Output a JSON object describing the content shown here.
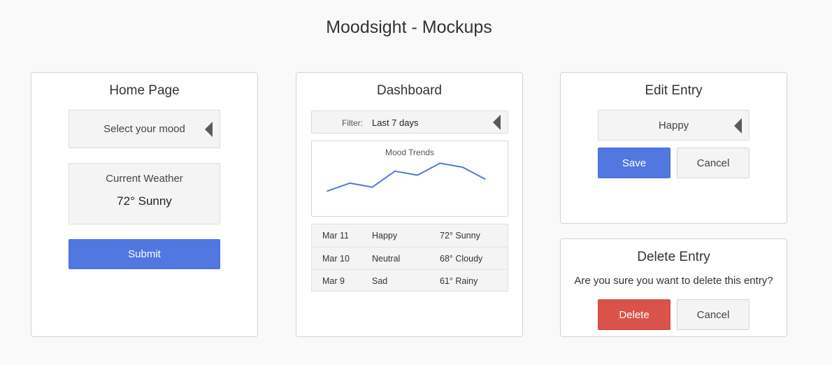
{
  "page": {
    "title": "Moodsight - Mockups"
  },
  "home": {
    "title": "Home Page",
    "mood_select": "Select your mood",
    "weather_label": "Current Weather",
    "weather_value": "72° Sunny",
    "submit_label": "Submit"
  },
  "dashboard": {
    "title": "Dashboard",
    "filter_label": "Filter:",
    "filter_value": "Last 7 days",
    "entries": [
      {
        "date": "Mar 11",
        "mood": "Happy",
        "weather": "72° Sunny"
      },
      {
        "date": "Mar 10",
        "mood": "Neutral",
        "weather": "68° Cloudy"
      },
      {
        "date": "Mar 9",
        "mood": "Sad",
        "weather": "61° Rainy"
      }
    ]
  },
  "chart_data": {
    "type": "line",
    "title": "Mood Trends",
    "xlabel": "",
    "ylabel": "",
    "grid": false,
    "series": [
      {
        "values": [
          1,
          3,
          2,
          6,
          5,
          8,
          7,
          4
        ]
      }
    ],
    "ylim": [
      0,
      10
    ],
    "color": "#5277e0"
  },
  "edit": {
    "title": "Edit Entry",
    "mood_value": "Happy",
    "save_label": "Save",
    "cancel_label": "Cancel"
  },
  "delete": {
    "title": "Delete Entry",
    "message": "Are you sure you want to delete this entry?",
    "delete_label": "Delete",
    "cancel_label": "Cancel"
  },
  "colors": {
    "primary": "#5277e0",
    "danger": "#d9534a",
    "neutral": "#f4f4f4"
  }
}
